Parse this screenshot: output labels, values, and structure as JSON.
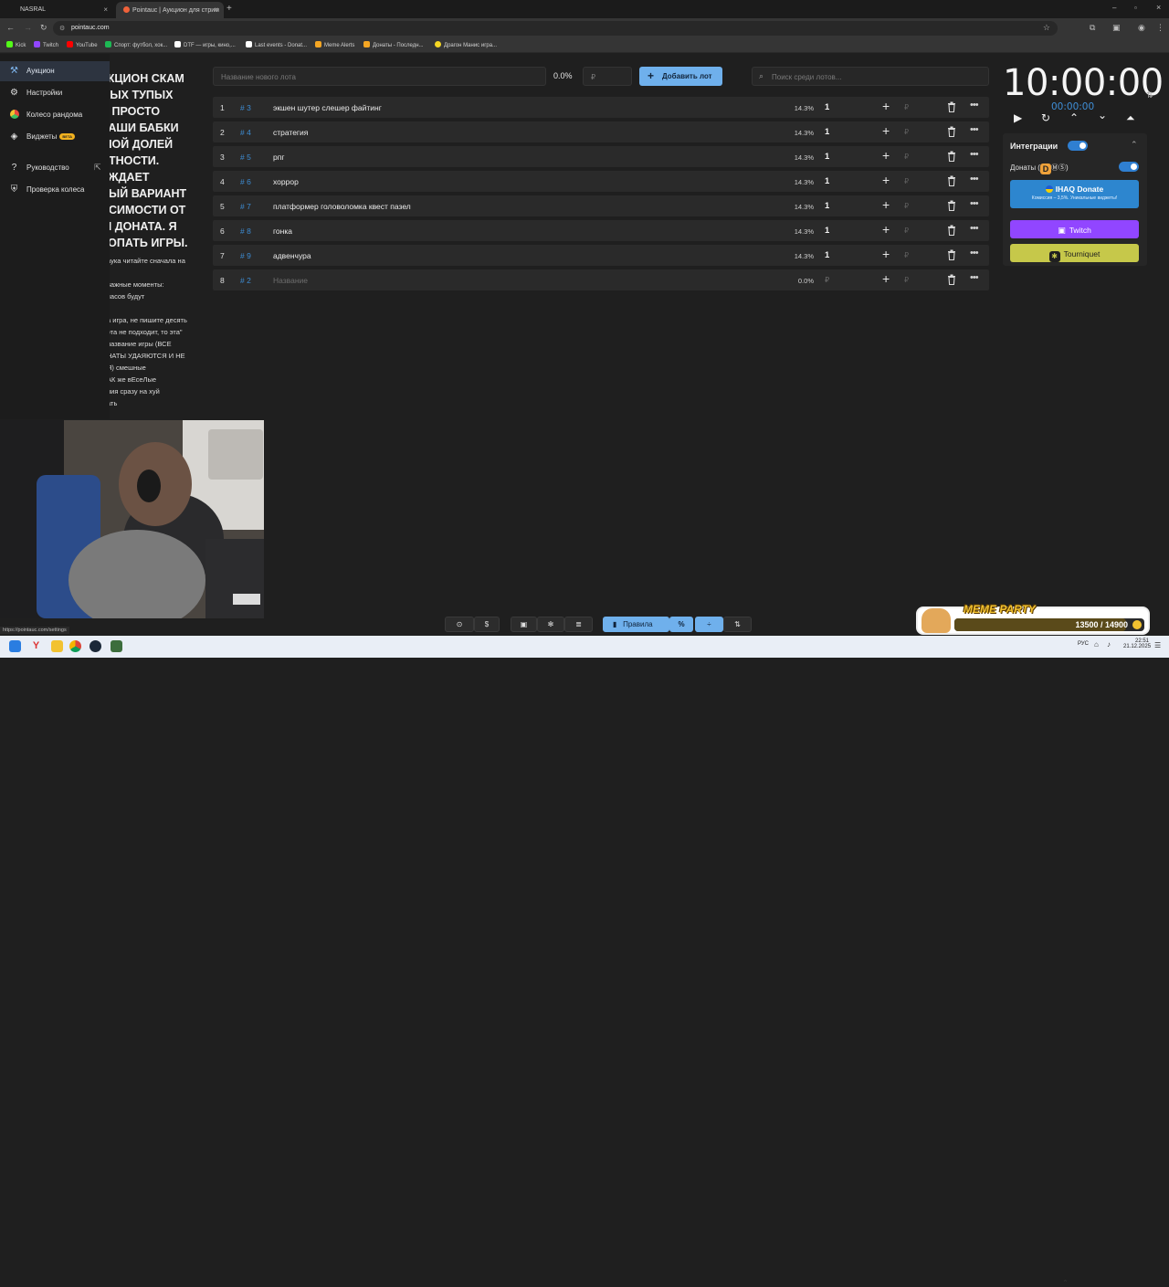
{
  "browser": {
    "tabs": [
      {
        "title": "NASRAL",
        "active": false
      },
      {
        "title": "Pointauc | Аукцион для стрим",
        "active": true
      }
    ],
    "url": "pointauc.com",
    "status_url": "https://pointauc.com/settings",
    "bookmarks": [
      {
        "label": "Kick",
        "color": "#53fc18"
      },
      {
        "label": "Twitch",
        "color": "#9146ff"
      },
      {
        "label": "YouTube",
        "color": "#ff0000"
      },
      {
        "label": "Спорт: футбол, хок...",
        "color": "#1db954"
      },
      {
        "label": "DTF — игры, кино,...",
        "color": "#ffffff"
      },
      {
        "label": "Last events - Donat...",
        "color": "#ffffff"
      },
      {
        "label": "Meme Alerts",
        "color": "#f5a623"
      },
      {
        "label": "Донаты - Последн...",
        "color": "#f5a623"
      },
      {
        "label": "Драгон Манис игра...",
        "color": "#f5d623"
      }
    ]
  },
  "sidebar": {
    "items": [
      {
        "label": "Аукцион",
        "icon": "gavel-icon",
        "active": true
      },
      {
        "label": "Настройки",
        "icon": "gear-icon",
        "active": false
      },
      {
        "label": "Колесо рандома",
        "icon": "wheel-icon",
        "active": false
      },
      {
        "label": "Виджеты",
        "icon": "layers-icon",
        "active": false,
        "badge": "BETA"
      },
      {
        "label": "Руководство",
        "icon": "help-icon",
        "active": false
      },
      {
        "label": "Проверка колеса",
        "icon": "shield-check-icon",
        "active": false
      }
    ]
  },
  "rules": {
    "big": "УКЦИОН СКАМ\nМЫХ ТУПЫХ\nЯ ПРОСТО\nВАШИ БАБКИ\nШОЙ ДОЛЕЙ\nЯТНОСТИ.\nЕЖДАЕТ\nНЫЙ ВАРИАНТ\nИСИМОСТИ ОТ\nЫ ДОНАТА. Я\nРОПАТЬ ИГРЫ.",
    "small": "аука читайте сначала на\n\nважные моменты:\nчасов будут\n\nа игра, не пишите десять\nэта не подходит, то эта\"\nназвание игры (ВСЕ\nНАТЫ УДАЯЮТСЯ И НЕ\nЯ) смешные\nАК же вЕсеЛые\nния сразу на хуй\nать"
  },
  "top_row": {
    "new_lot_placeholder": "Название нового лота",
    "percent": "0.0%",
    "amount_placeholder": "₽",
    "add_button": "Добавить лот",
    "search_placeholder": "Поиск среди лотов..."
  },
  "lots": [
    {
      "num": "1",
      "id": "# 3",
      "name": "экшен шутер слешер файтинг",
      "pct": "14.3%",
      "amount": "1"
    },
    {
      "num": "2",
      "id": "# 4",
      "name": "стратегия",
      "pct": "14.3%",
      "amount": "1"
    },
    {
      "num": "3",
      "id": "# 5",
      "name": "рпг",
      "pct": "14.3%",
      "amount": "1"
    },
    {
      "num": "4",
      "id": "# 6",
      "name": "хоррор",
      "pct": "14.3%",
      "amount": "1"
    },
    {
      "num": "5",
      "id": "# 7",
      "name": "платформер головоломка квест пазел",
      "pct": "14.3%",
      "amount": "1"
    },
    {
      "num": "6",
      "id": "# 8",
      "name": "гонка",
      "pct": "14.3%",
      "amount": "1"
    },
    {
      "num": "7",
      "id": "# 9",
      "name": "адвенчура",
      "pct": "14.3%",
      "amount": "1"
    },
    {
      "num": "8",
      "id": "# 2",
      "name": "Название",
      "pct": "0.0%",
      "amount": "",
      "placeholder": true
    }
  ],
  "rub_sign": "₽",
  "timer": {
    "main": "10:00:00",
    "sub": "00:00:00"
  },
  "integrations": {
    "title": "Интеграции",
    "donations_label": "Донаты (",
    "donations_suffix": "ⓂⓈ)",
    "ihaq_title": "IHAQ Donate",
    "ihaq_sub": "Комиссия – 3,5%. Уникальные виджеты!",
    "twitch": "Twitch",
    "tourniquet": "Tourniquet"
  },
  "toolbar": {
    "rules_label": "Правила"
  },
  "meme_party": {
    "title": "MEME PARTY",
    "progress": "13500 / 14900",
    "current": 13500,
    "goal": 14900
  },
  "taskbar": {
    "lang": "РУС",
    "time": "22:51",
    "date": "21.12.2025"
  },
  "colors": {
    "accent": "#6fb0ec",
    "id_blue": "#3d8bd1",
    "twitch": "#9146ff",
    "tourniquet": "#c6c84a"
  }
}
